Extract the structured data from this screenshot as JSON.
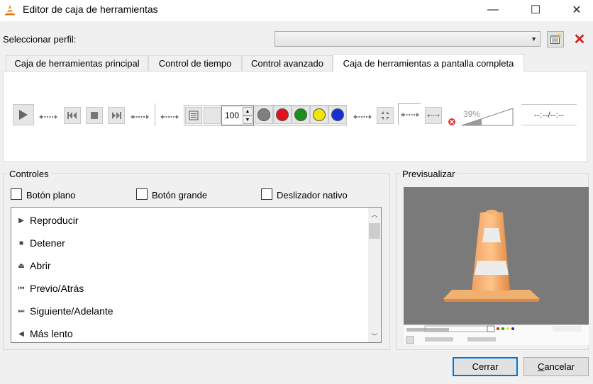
{
  "window": {
    "title": "Editor de caja de herramientas",
    "minimize_glyph": "—",
    "maximize_glyph": "☐",
    "close_glyph": "✕"
  },
  "profile": {
    "label": "Seleccionar perfil:",
    "selected": ""
  },
  "tabs": [
    {
      "label": "Caja de herramientas principal",
      "active": false
    },
    {
      "label": "Control de tiempo",
      "active": false
    },
    {
      "label": "Control avanzado",
      "active": false
    },
    {
      "label": "Caja de herramientas a pantalla completa",
      "active": true
    }
  ],
  "toolbar": {
    "zoom_value": "100",
    "volume_percent": "39%",
    "volume_level": 0.39,
    "time_label": "--:--/--:--",
    "colors": [
      "#808080",
      "#e3121b",
      "#1a8f1a",
      "#f2e600",
      "#1630d6"
    ]
  },
  "controls": {
    "title": "Controles",
    "checkboxes": [
      {
        "label": "Botón plano",
        "checked": false
      },
      {
        "label": "Botón grande",
        "checked": false
      },
      {
        "label": "Deslizador nativo",
        "checked": false
      }
    ],
    "list": [
      {
        "label": "Reproducir",
        "icon": "play-icon",
        "glyph": "▶"
      },
      {
        "label": "Detener",
        "icon": "stop-icon",
        "glyph": "■"
      },
      {
        "label": "Abrir",
        "icon": "eject-icon",
        "glyph": "⏏"
      },
      {
        "label": "Previo/Atrás",
        "icon": "previous-icon",
        "glyph": "⏮"
      },
      {
        "label": "Siguiente/Adelante",
        "icon": "next-icon",
        "glyph": "⏭"
      },
      {
        "label": "Más lento",
        "icon": "slower-icon",
        "glyph": "◀"
      }
    ]
  },
  "preview": {
    "title": "Previsualizar"
  },
  "buttons": {
    "close": "Cerrar",
    "cancel_first": "C",
    "cancel_rest": "ancelar"
  }
}
